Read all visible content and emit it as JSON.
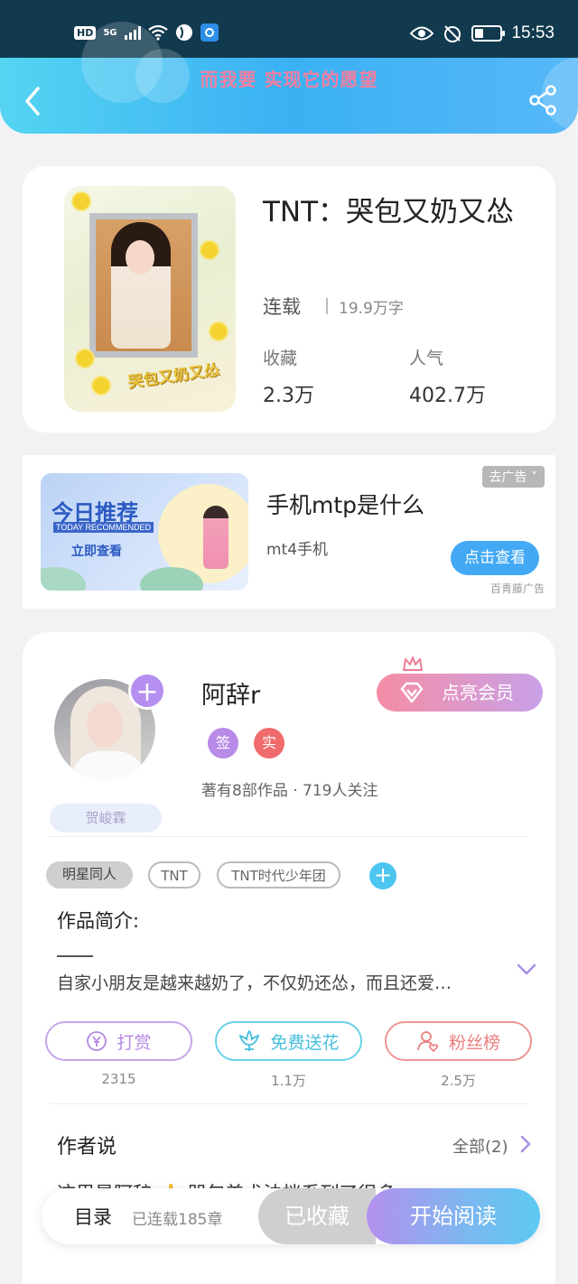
{
  "status_bar": {
    "hd": "HD",
    "network": "5G",
    "time": "15:53"
  },
  "header": {
    "title": "而我要 实现它的愿望",
    "accent_color": "#3ab1f3"
  },
  "book": {
    "title": "TNT：哭包又奶又怂",
    "cover_text": "哭包又奶又怂",
    "status": "连载",
    "word_count": "19.9万字",
    "favorites_label": "收藏",
    "favorites_value": "2.3万",
    "popularity_label": "人气",
    "popularity_value": "402.7万"
  },
  "ad": {
    "badge": "去广告 ˅",
    "image_title": "今日推荐",
    "image_sub": "TODAY RECOMMENDED",
    "image_cta": "立即查看",
    "title": "手机mtp是什么",
    "subtitle": "mt4手机",
    "button": "点击查看",
    "source": "百青藤广告"
  },
  "author": {
    "name": "阿辞r",
    "vip_button": "点亮会员",
    "badge_sign": "签",
    "badge_real": "实",
    "stats": "著有8部作品 · 719人关注",
    "tag": "贺峻霖"
  },
  "tags": [
    "明星同人",
    "TNT",
    "TNT时代少年团"
  ],
  "intro": {
    "label": "作品简介:",
    "text": "自家小朋友是越来越奶了，不仅奶还怂，而且还爱…"
  },
  "actions": [
    {
      "label": "打赏",
      "count": "2315",
      "icon": "yen-coin-icon"
    },
    {
      "label": "免费送花",
      "count": "1.1万",
      "icon": "flower-icon"
    },
    {
      "label": "粉丝榜",
      "count": "2.5万",
      "icon": "fan-user-icon"
    }
  ],
  "author_says": {
    "label": "作者说",
    "all": "全部(2)",
    "preview": "这里是阿辞 👍 咒包美术法档系列了很多"
  },
  "bottom_bar": {
    "toc": "目录",
    "chapters": "已连载185章",
    "collected": "已收藏",
    "read": "开始阅读"
  }
}
